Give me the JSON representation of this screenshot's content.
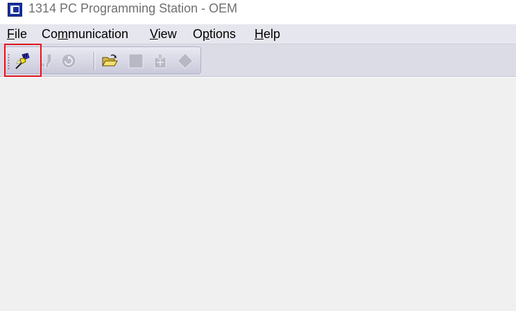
{
  "window": {
    "title": "1314 PC Programming Station - OEM",
    "app_icon": "app-logo-icon"
  },
  "menubar": {
    "items": [
      {
        "label": "File",
        "mnemonic": "F"
      },
      {
        "label": "Communication",
        "mnemonic": "m"
      },
      {
        "label": "View",
        "mnemonic": "V"
      },
      {
        "label": "Options",
        "mnemonic": "p"
      },
      {
        "label": "Help",
        "mnemonic": "H"
      }
    ]
  },
  "toolbar": {
    "buttons": [
      {
        "icon": "connect-icon",
        "enabled": true,
        "highlighted": true
      },
      {
        "icon": "disconnect-icon",
        "enabled": false
      },
      {
        "icon": "refresh-icon",
        "enabled": false
      },
      {
        "icon": "open-folder-icon",
        "enabled": true
      },
      {
        "icon": "stop-icon",
        "enabled": false
      },
      {
        "icon": "download-icon",
        "enabled": false
      },
      {
        "icon": "diamond-icon",
        "enabled": false
      }
    ]
  },
  "colors": {
    "highlight_border": "#e0151c",
    "menubar_bg": "#e6e6ee",
    "client_bg": "#f0f0f0",
    "app_icon_blue": "#1733a0"
  }
}
